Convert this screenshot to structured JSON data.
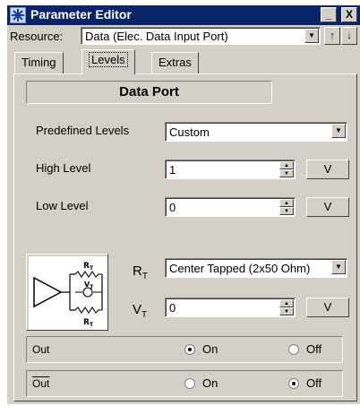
{
  "window": {
    "title": "Parameter Editor",
    "minimize_glyph": "_",
    "close_glyph": "X"
  },
  "resource": {
    "label": "Resource:",
    "value": "Data (Elec. Data Input Port)"
  },
  "tabs": [
    {
      "label": "Timing",
      "active": false
    },
    {
      "label": "Levels",
      "active": true
    },
    {
      "label": "Extras",
      "active": false
    }
  ],
  "panel": {
    "heading": "Data Port",
    "predefined": {
      "label": "Predefined Levels",
      "value": "Custom"
    },
    "high": {
      "label": "High Level",
      "value": "1",
      "unit": "V"
    },
    "low": {
      "label": "Low Level",
      "value": "0",
      "unit": "V"
    },
    "rt": {
      "symbol": "R",
      "sub": "T",
      "value": "Center Tapped (2x50 Ohm)"
    },
    "vt": {
      "symbol": "V",
      "sub": "T",
      "value": "0",
      "unit": "V"
    },
    "circuit": {
      "r_top": "R",
      "r_top_sub": "T",
      "v_mid": "V",
      "v_mid_sub": "T",
      "r_bot": "R",
      "r_bot_sub": "T"
    },
    "out": {
      "label": "Out",
      "on": "On",
      "off": "Off",
      "selected": "on"
    },
    "out_inv": {
      "label": "Out",
      "on": "On",
      "off": "Off",
      "selected": "off"
    }
  },
  "icons": [
    "app-icon",
    "minimize-icon",
    "close-icon",
    "dropdown-icon",
    "up-arrow-icon",
    "down-arrow-icon",
    "spin-up-icon",
    "spin-down-icon",
    "termination-circuit-icon"
  ]
}
